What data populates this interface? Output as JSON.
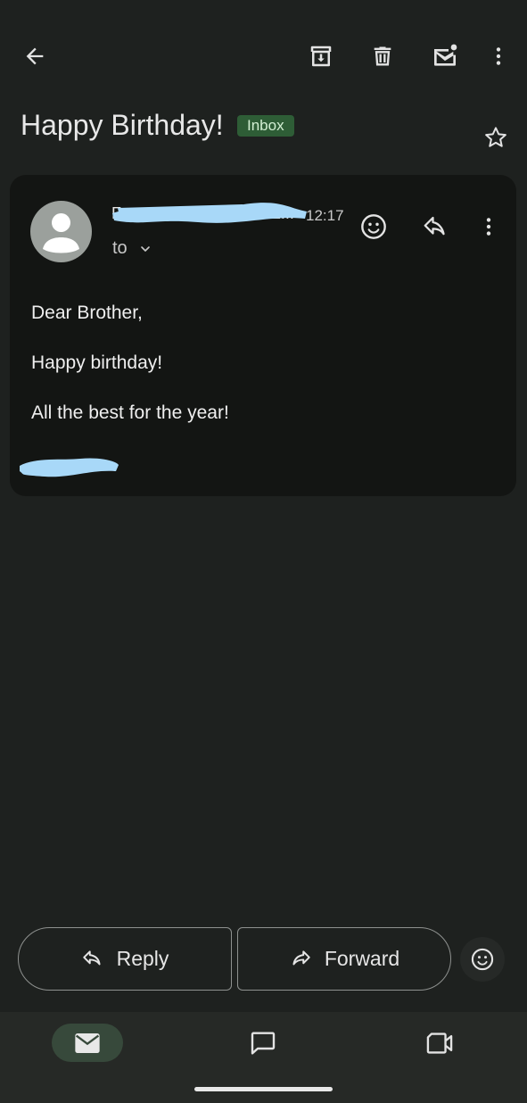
{
  "header": {
    "back_icon": "arrow-left-icon",
    "archive_icon": "archive-icon",
    "delete_icon": "trash-icon",
    "unread_icon": "mark-unread-icon",
    "more_icon": "more-vert-icon"
  },
  "email": {
    "subject": "Happy Birthday!",
    "label": "Inbox",
    "sender": "F______________2011...",
    "time": "12:17",
    "to_label": "to",
    "body": {
      "greeting": "Dear Brother,",
      "line2": "Happy birthday!",
      "line3": "All the best for the year!",
      "signature": "N_____"
    }
  },
  "actions": {
    "reply_label": "Reply",
    "forward_label": "Forward"
  },
  "colors": {
    "background": "#1e211f",
    "card": "#131513",
    "label_chip": "#2e5d36",
    "redaction": "#a8d8f8",
    "nav_active": "#37493b"
  },
  "nav": {
    "items": [
      "mail-icon",
      "chat-icon",
      "meet-video-icon"
    ],
    "active": "mail-icon"
  }
}
